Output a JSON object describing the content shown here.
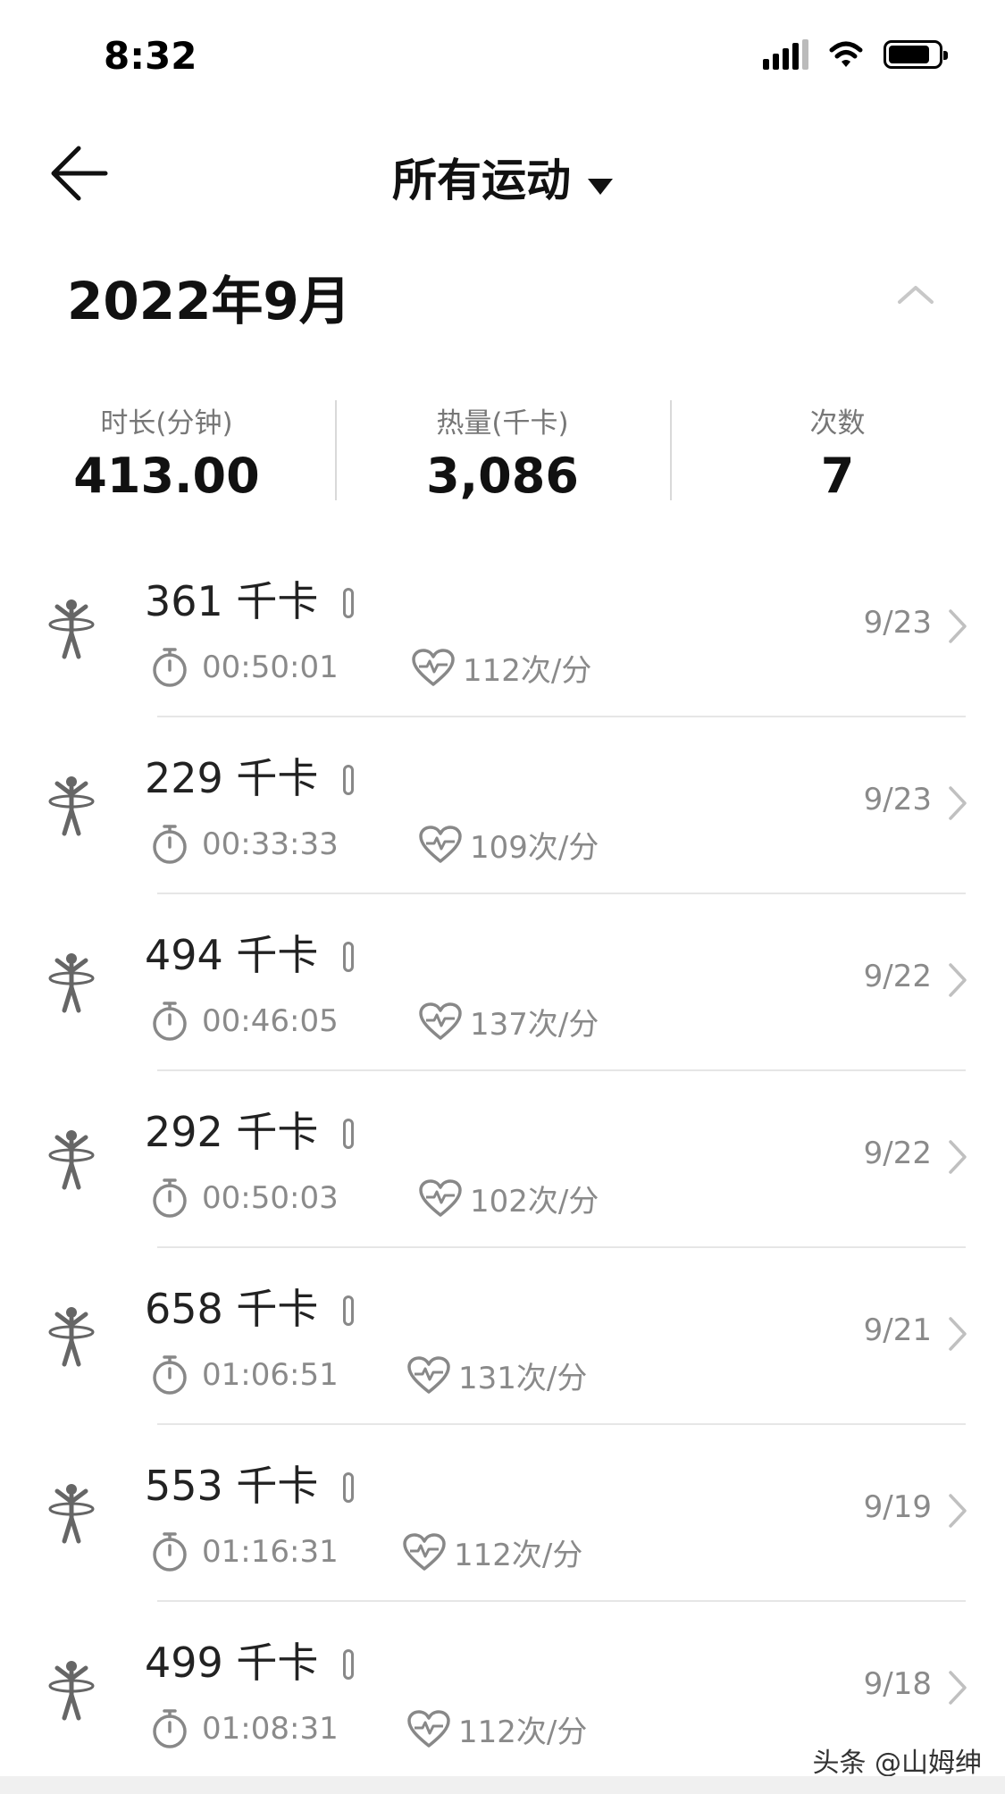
{
  "status_bar": {
    "time": "8:32"
  },
  "nav": {
    "title": "所有运动"
  },
  "month": {
    "label": "2022年9月"
  },
  "summary": {
    "duration_label": "时长(分钟)",
    "duration_value": "413.00",
    "calories_label": "热量(千卡)",
    "calories_value": "3,086",
    "count_label": "次数",
    "count_value": "7"
  },
  "records": [
    {
      "kcal": "361 千卡",
      "duration": "00:50:01",
      "heart_rate": "112次/分",
      "date": "9/23"
    },
    {
      "kcal": "229 千卡",
      "duration": "00:33:33",
      "heart_rate": "109次/分",
      "date": "9/23"
    },
    {
      "kcal": "494 千卡",
      "duration": "00:46:05",
      "heart_rate": "137次/分",
      "date": "9/22"
    },
    {
      "kcal": "292 千卡",
      "duration": "00:50:03",
      "heart_rate": "102次/分",
      "date": "9/22"
    },
    {
      "kcal": "658 千卡",
      "duration": "01:06:51",
      "heart_rate": "131次/分",
      "date": "9/21"
    },
    {
      "kcal": "553 千卡",
      "duration": "01:16:31",
      "heart_rate": "112次/分",
      "date": "9/19"
    },
    {
      "kcal": "499 千卡",
      "duration": "01:08:31",
      "heart_rate": "112次/分",
      "date": "9/18"
    }
  ],
  "watermark": "头条 @山姆绅",
  "icons": {
    "sport": "hula-hoop-icon",
    "band": "fitness-band-icon",
    "timer": "stopwatch-icon",
    "heart": "heart-rate-icon",
    "chevron": "chevron-right-icon"
  }
}
